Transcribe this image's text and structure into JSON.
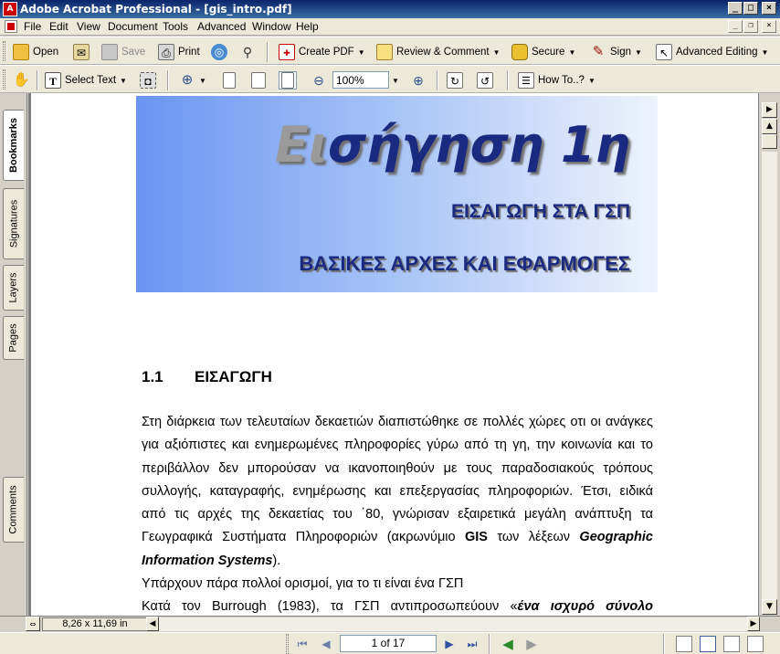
{
  "window": {
    "title": "Adobe Acrobat Professional - [gis_intro.pdf]",
    "app_icon": "acrobat-icon"
  },
  "menubar": [
    "File",
    "Edit",
    "View",
    "Document",
    "Tools",
    "Advanced",
    "Window",
    "Help"
  ],
  "toolbar1": {
    "open": "Open",
    "save": "Save",
    "print": "Print",
    "create_pdf": "Create PDF",
    "review": "Review & Comment",
    "secure": "Secure",
    "sign": "Sign",
    "advanced_editing": "Advanced Editing"
  },
  "toolbar2": {
    "select_text": "Select Text",
    "zoom": "100%",
    "how_to": "How To..?"
  },
  "side_tabs": [
    "Bookmarks",
    "Signatures",
    "Layers",
    "Pages",
    "Comments"
  ],
  "document": {
    "banner": {
      "title_grey": "Ει",
      "title_rest": "σήγηση 1η",
      "subtitle1": "ΕΙΣΑΓΩΓΗ ΣΤΑ ΓΣΠ",
      "subtitle2": "ΒΑΣΙΚΕΣ ΑΡΧΕΣ ΚΑΙ ΕΦΑΡΜΟΓΕΣ"
    },
    "section": {
      "number": "1.1",
      "title": "ΕΙΣΑΓΩΓΗ"
    },
    "lines": [
      "Στη διάρκεια των τελευταίων δεκαετιών διαπιστώθηκε σε πολλές χώρες οτι οι ανάγκες",
      "για αξιόπιστες και ενημερωμένες πληροφορίες γύρω από τη γη, την κοινωνία και το",
      "περιβάλλον δεν μπορούσαν να ικανοποιηθούν με τους παραδοσιακούς τρόπους",
      "συλλογής, καταγραφής, ενημέρωσης και επεξεργασίας πληροφοριών. Έτσι, ειδικά",
      "από τις αρχές της δεκαετίας του ΄80, γνώρισαν εξαιρετικά μεγάλη ανάπτυξη τα"
    ],
    "line6_pre": "Γεωγραφικά Συστήματα Πληροφοριών (ακρωνύμιο",
    "line6_bold": "GIS",
    "line6_mid": "των λέξεων",
    "line6_bolditalic": "Geographic",
    "line7_bolditalic": "Information Systems",
    "line7_post": ").",
    "line8": "Υπάρχουν πάρα πολλοί ορισμοί, για το τι είναι ένα ΓΣΠ",
    "line9_pre": "Κατά τον Burrough (1983), τα ΓΣΠ αντιπροσωπεύουν «",
    "line9_bolditalic": "ένα ισχυρό σύνολο"
  },
  "status": {
    "page_size": "8,26 x 11,69 in",
    "page_indicator": "1 of 17"
  }
}
